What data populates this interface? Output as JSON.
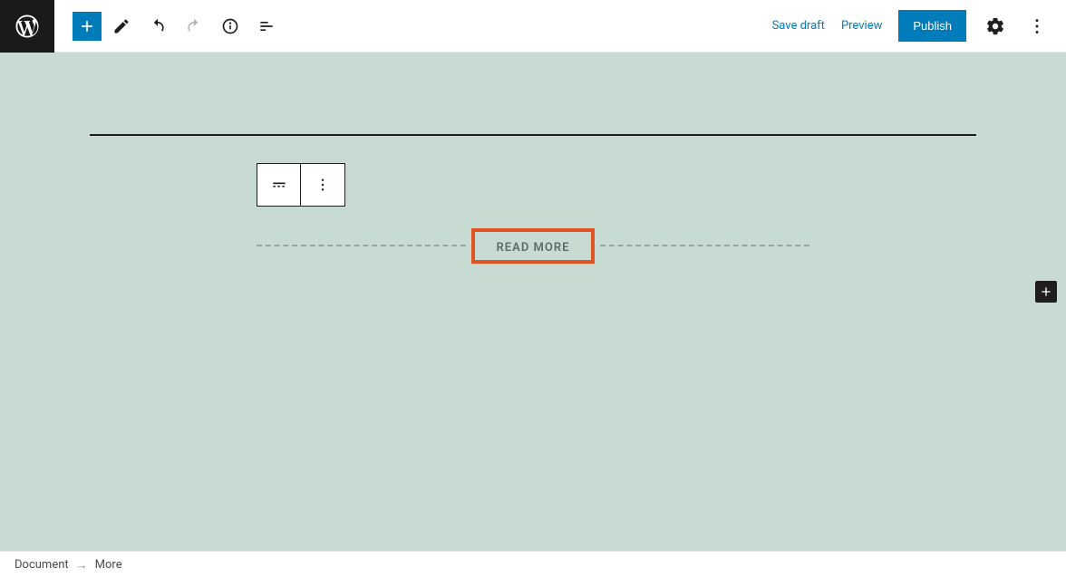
{
  "toolbar": {
    "save_draft": "Save draft",
    "preview": "Preview",
    "publish": "Publish"
  },
  "block": {
    "read_more_label": "READ MORE"
  },
  "breadcrumb": {
    "root": "Document",
    "separator": "→",
    "current": "More"
  }
}
